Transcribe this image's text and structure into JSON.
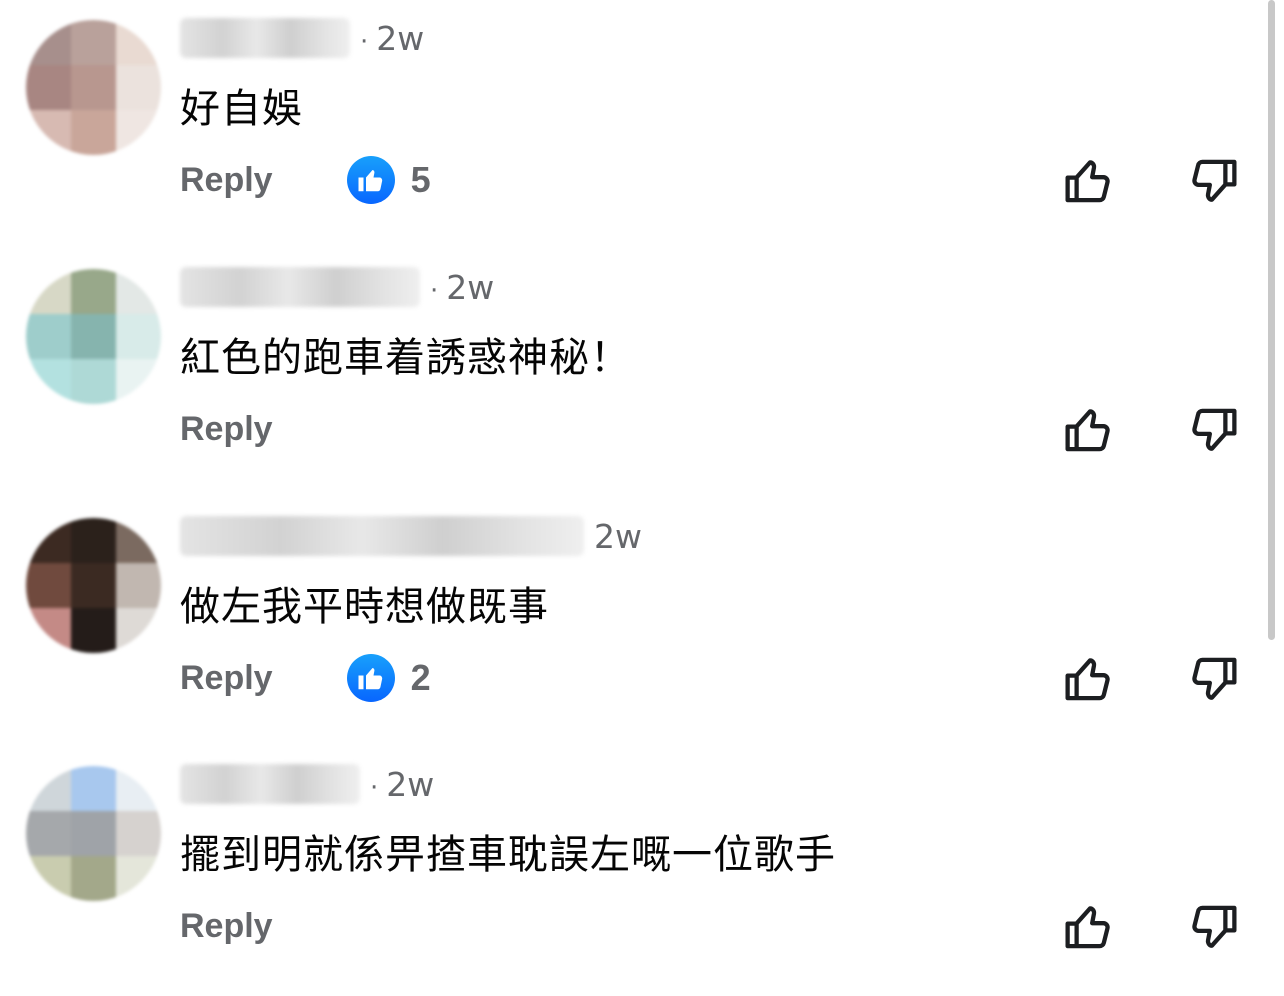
{
  "comments": [
    {
      "time": "2w",
      "text": "好自娛",
      "reply_label": "Reply",
      "reaction_count": "5",
      "avatar_colors": [
        "#a78f8c",
        "#b9a19b",
        "#e9dad2",
        "#a88682",
        "#b8978f",
        "#ebe2dd",
        "#d7bab2",
        "#c9a69a",
        "#efe6e2"
      ]
    },
    {
      "time": "2w",
      "text": "紅色的跑車着誘惑神秘！",
      "reply_label": "Reply",
      "reaction_count": null,
      "avatar_colors": [
        "#d7d8c6",
        "#98a88a",
        "#e3e8e6",
        "#9ecdcb",
        "#86b4ae",
        "#d8ebe9",
        "#b3e1e0",
        "#aed9d6",
        "#e9f3f2"
      ]
    },
    {
      "time": "2w",
      "text": "做左我平時想做既事",
      "reply_label": "Reply",
      "reaction_count": "2",
      "avatar_colors": [
        "#3c2a22",
        "#2b211b",
        "#7b6a60",
        "#704a3e",
        "#3b2a22",
        "#c1b7b0",
        "#c48a86",
        "#241c19",
        "#dedad6"
      ]
    },
    {
      "time": "2w",
      "text": "擺到明就係畀揸車耽誤左嘅一位歌手",
      "reply_label": "Reply",
      "reaction_count": null,
      "avatar_colors": [
        "#cfd6da",
        "#a8c8ee",
        "#e8eef3",
        "#a5a8ab",
        "#9fa3a8",
        "#d6d2cf",
        "#c9ccaf",
        "#a3a88a",
        "#e4e6da"
      ]
    }
  ],
  "colors": {
    "accent": "#0866ff",
    "secondary_text": "#65676b"
  }
}
